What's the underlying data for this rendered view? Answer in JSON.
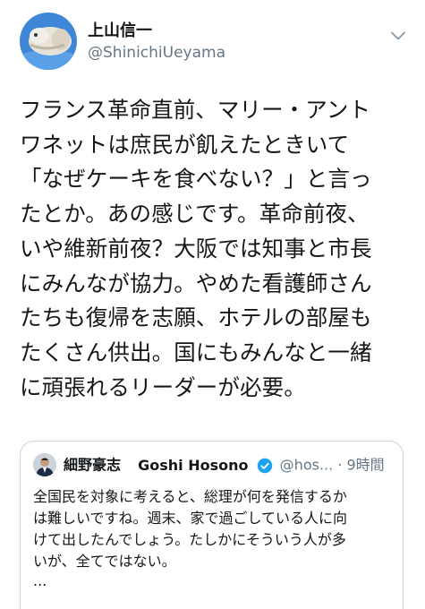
{
  "tweet": {
    "author": {
      "display_name": "上山信一",
      "handle": "@ShinichiUeyama"
    },
    "menu_icon": "chevron-down-icon",
    "text": "フランス革命直前、マリー・アント\nワネットは庶民が飢えたときいて\n「なぜケーキを食べない？」と言っ\nたとか。あの感じです。革命前夜、\nいや維新前夜？大阪では知事と市長\nにみんなが協力。やめた看護師さん\nたちも復帰を志願、ホテルの部屋も\nたくさん供出。国にもみんなと一緒\nに頑張れるリーダーが必要。"
  },
  "quoted_tweet": {
    "author_name_jp": "細野豪志",
    "author_name_en": "Goshi Hosono",
    "verified_icon": "verified-badge-icon",
    "handle": "@hos...",
    "separator": "·",
    "time": "9時間",
    "text": "全国民を対象に考えると、総理が何を発信するか\nは難しいですね。週末、家で過ごしている人に向\nけて出したんでしょう。たしかにそういう人が多\nいが、全てではない。",
    "truncation": "..."
  },
  "colors": {
    "text_primary": "#14171a",
    "text_secondary": "#657786",
    "verified_blue": "#1da1f2",
    "card_border": "#ccd6dd"
  }
}
